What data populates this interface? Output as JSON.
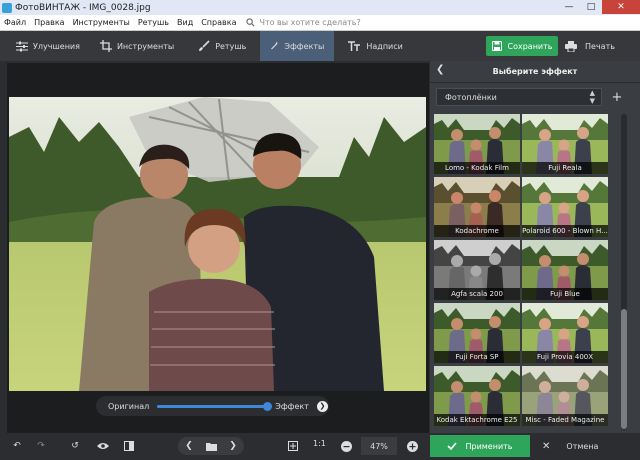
{
  "window": {
    "title": "ФотоВИНТАЖ - IMG_0028.jpg"
  },
  "menu": {
    "items": [
      "Файл",
      "Правка",
      "Инструменты",
      "Ретушь",
      "Вид",
      "Справка"
    ],
    "search_placeholder": "Что вы хотите сделать?"
  },
  "toolbar": {
    "tabs": [
      {
        "label": "Улучшения",
        "icon": "sliders-icon"
      },
      {
        "label": "Инструменты",
        "icon": "crop-icon"
      },
      {
        "label": "Ретушь",
        "icon": "brush-icon"
      },
      {
        "label": "Эффекты",
        "icon": "magic-wand-icon"
      },
      {
        "label": "Надписи",
        "icon": "text-icon"
      }
    ],
    "active_tab": "Эффекты",
    "save_label": "Сохранить",
    "print_label": "Печать"
  },
  "compare": {
    "left_label": "Оригинал",
    "right_label": "Эффект",
    "position": 1.0
  },
  "bottom": {
    "fit_label": "1:1",
    "zoom": "47%"
  },
  "panel": {
    "title": "Выберите эффект",
    "category": "Фотоплёнки",
    "effects": [
      "Lomo - Kodak Film",
      "Fuji Reala",
      "Kodachrome",
      "Polaroid 600 - Blown H...",
      "Agfa scala 200",
      "Fuji Blue",
      "Fuji Forta SP",
      "Fuji Provia 400X",
      "Kodak Ektachrome E25",
      "Misc - Faded Magazine"
    ],
    "apply_label": "Применить",
    "cancel_label": "Отмена"
  },
  "colors": {
    "accent_green": "#2ea55a",
    "active_tab": "#4b5f79",
    "slider_blue": "#3f87d8"
  }
}
